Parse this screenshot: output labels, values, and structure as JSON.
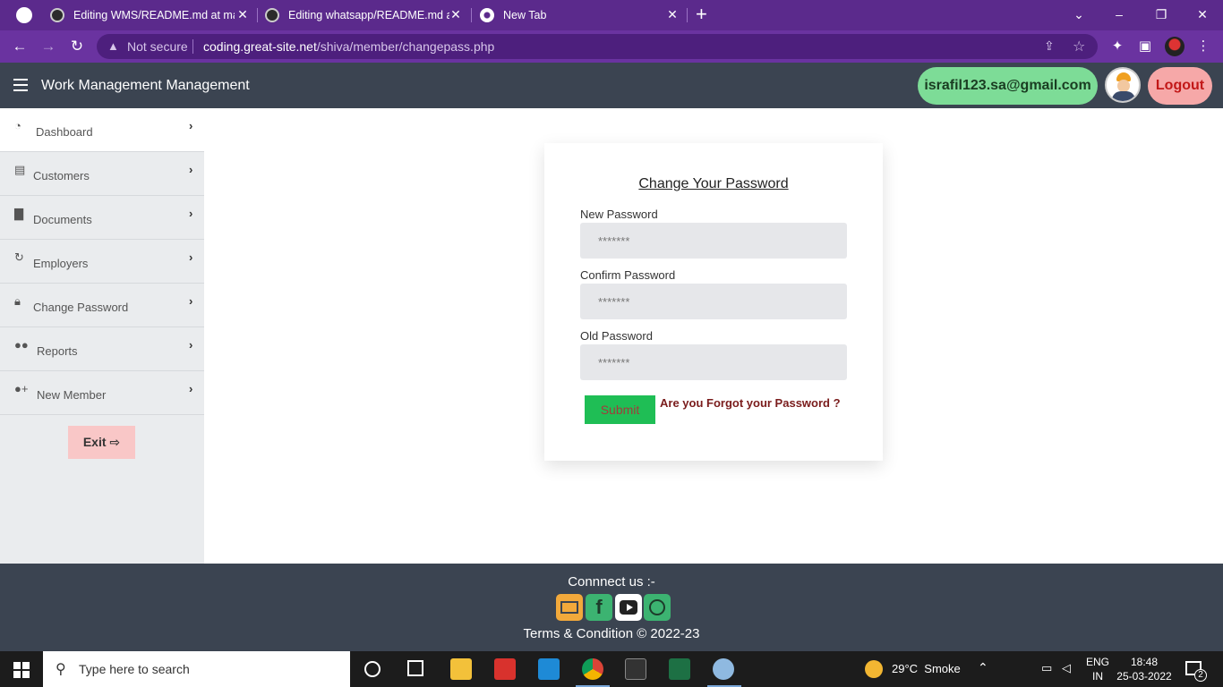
{
  "browser": {
    "tabs": [
      {
        "title": "Editing WMS/README.md at ma",
        "icon": "github-icon"
      },
      {
        "title": "Editing whatsapp/README.md at",
        "icon": "github-icon"
      },
      {
        "title": "New Tab",
        "icon": "chrome-icon"
      }
    ],
    "new_tab_symbol": "+",
    "not_secure_label": "Not secure",
    "url_host": "coding.great-site.net",
    "url_path": "/shiva/member/changepass.php"
  },
  "app": {
    "title": "Work Management Management",
    "user_email": "israfil123.sa@gmail.com",
    "logout_label": "Logout"
  },
  "sidebar": {
    "items": [
      {
        "label": "Dashboard",
        "icon": "dashboard-icon"
      },
      {
        "label": "Customers",
        "icon": "customers-icon"
      },
      {
        "label": "Documents",
        "icon": "documents-icon"
      },
      {
        "label": "Employers",
        "icon": "employers-icon"
      },
      {
        "label": "Change Password",
        "icon": "lock-icon"
      },
      {
        "label": "Reports",
        "icon": "users-icon"
      },
      {
        "label": "New Member",
        "icon": "user-plus-icon"
      }
    ],
    "exit_label": "Exit"
  },
  "form": {
    "title": "Change Your Password",
    "new_password_label": "New Password",
    "new_password_placeholder": "*******",
    "confirm_password_label": "Confirm Password",
    "confirm_password_placeholder": "*******",
    "old_password_label": "Old Password",
    "old_password_placeholder": "*******",
    "submit_label": "Submit",
    "forgot_label": "Are you Forgot your Password ?"
  },
  "footer": {
    "connect_label": "Connnect us :-",
    "terms": "Terms & Condition © 2022-23"
  },
  "taskbar": {
    "search_placeholder": "Type here to search",
    "weather": "29°C  Smoke",
    "lang_line1": "ENG",
    "lang_line2": "IN",
    "time": "18:48",
    "date": "25-03-2022",
    "notifications": "2"
  }
}
